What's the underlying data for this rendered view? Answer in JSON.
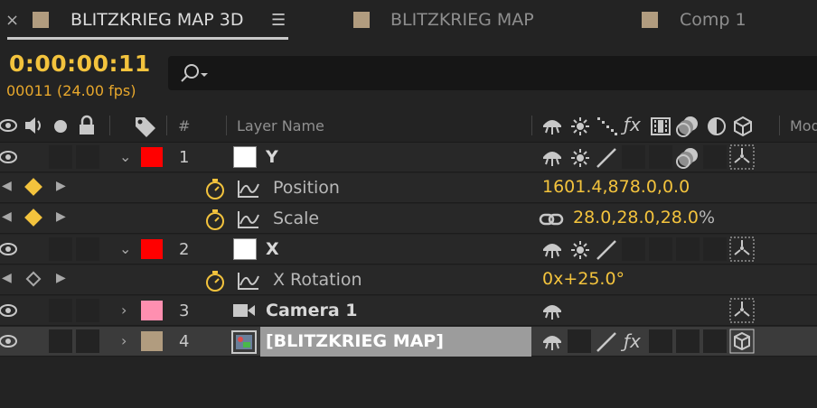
{
  "tabs": [
    {
      "label": "BLITZKRIEG MAP 3D",
      "active": true,
      "swatch": "#b19c7f"
    },
    {
      "label": "BLITZKRIEG MAP",
      "active": false,
      "swatch": "#b19c7f"
    },
    {
      "label": "Comp 1",
      "active": false,
      "swatch": "#b19c7f"
    }
  ],
  "header": {
    "close_glyph": "×",
    "menu_glyph": "☰",
    "timecode": "0:00:00:11",
    "frames": "00011 (24.00 fps)",
    "search_placeholder": ""
  },
  "columns": {
    "number": "#",
    "layer_name": "Layer Name",
    "mode": "Mod"
  },
  "layers": [
    {
      "index": "1",
      "name": "Y",
      "label_color": "#ff0000"
    },
    {
      "index": "2",
      "name": "X",
      "label_color": "#ff0000"
    },
    {
      "index": "3",
      "name": "Camera 1",
      "label_color": "#ff8fb0"
    },
    {
      "index": "4",
      "name": "[BLITZKRIEG MAP]",
      "label_color": "#b19c7f",
      "selected": true
    }
  ],
  "properties": [
    {
      "name": "Position",
      "value": "1601.4,878.0,0.0"
    },
    {
      "name": "Scale",
      "value": "28.0,28.0,28.0",
      "unit": "%"
    },
    {
      "name": "X Rotation",
      "value": "0x+25.0°"
    }
  ],
  "colors": {
    "accent_time": "#f3c33d",
    "keyframe": "#f3c33d",
    "label_red": "#ff0000",
    "label_pink": "#ff8fb0",
    "label_tan": "#b19c7f"
  },
  "icons": [
    "eye-icon",
    "speaker-icon",
    "solo-icon",
    "lock-icon",
    "label-tag-icon",
    "shy-icon",
    "collapse-icon",
    "quality-icon",
    "effects-icon",
    "frame-blend-icon",
    "motion-blur-icon",
    "adjustment-icon",
    "3d-layer-icon",
    "stopwatch-icon",
    "graph-icon",
    "chain-link-icon",
    "camera-icon",
    "search-icon"
  ]
}
